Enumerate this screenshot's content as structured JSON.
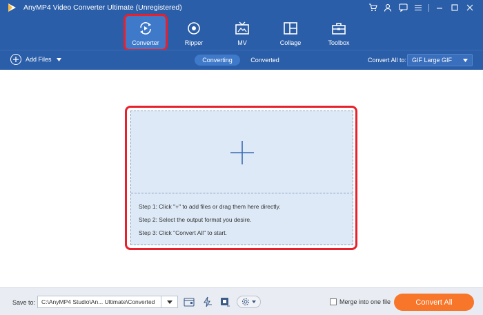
{
  "window": {
    "title": "AnyMP4 Video Converter Ultimate (Unregistered)"
  },
  "nav": {
    "items": [
      {
        "label": "Converter",
        "icon": "converter-icon",
        "active": true
      },
      {
        "label": "Ripper",
        "icon": "disc-icon",
        "active": false
      },
      {
        "label": "MV",
        "icon": "tv-icon",
        "active": false
      },
      {
        "label": "Collage",
        "icon": "collage-icon",
        "active": false
      },
      {
        "label": "Toolbox",
        "icon": "toolbox-icon",
        "active": false
      }
    ]
  },
  "toolbar": {
    "add_files_label": "Add Files",
    "tabs": [
      {
        "label": "Converting",
        "active": true
      },
      {
        "label": "Converted",
        "active": false
      }
    ],
    "convert_all_to_label": "Convert All to:",
    "format_value": "GIF Large GIF"
  },
  "dropzone": {
    "steps": [
      "Step 1: Click \"+\" to add files or drag them here directly.",
      "Step 2: Select the output format you desire.",
      "Step 3: Click \"Convert All\" to start."
    ]
  },
  "bottom": {
    "save_to_label": "Save to:",
    "path_value": "C:\\AnyMP4 Studio\\An... Ultimate\\Converted",
    "merge_label": "Merge into one file",
    "merge_checked": false,
    "convert_all_label": "Convert All"
  },
  "colors": {
    "header_bg": "#2b5ea8",
    "active_tab": "#3f79c9",
    "highlight_red": "#e8202b",
    "drop_bg": "#dde9f7",
    "accent_orange": "#f7762a"
  }
}
